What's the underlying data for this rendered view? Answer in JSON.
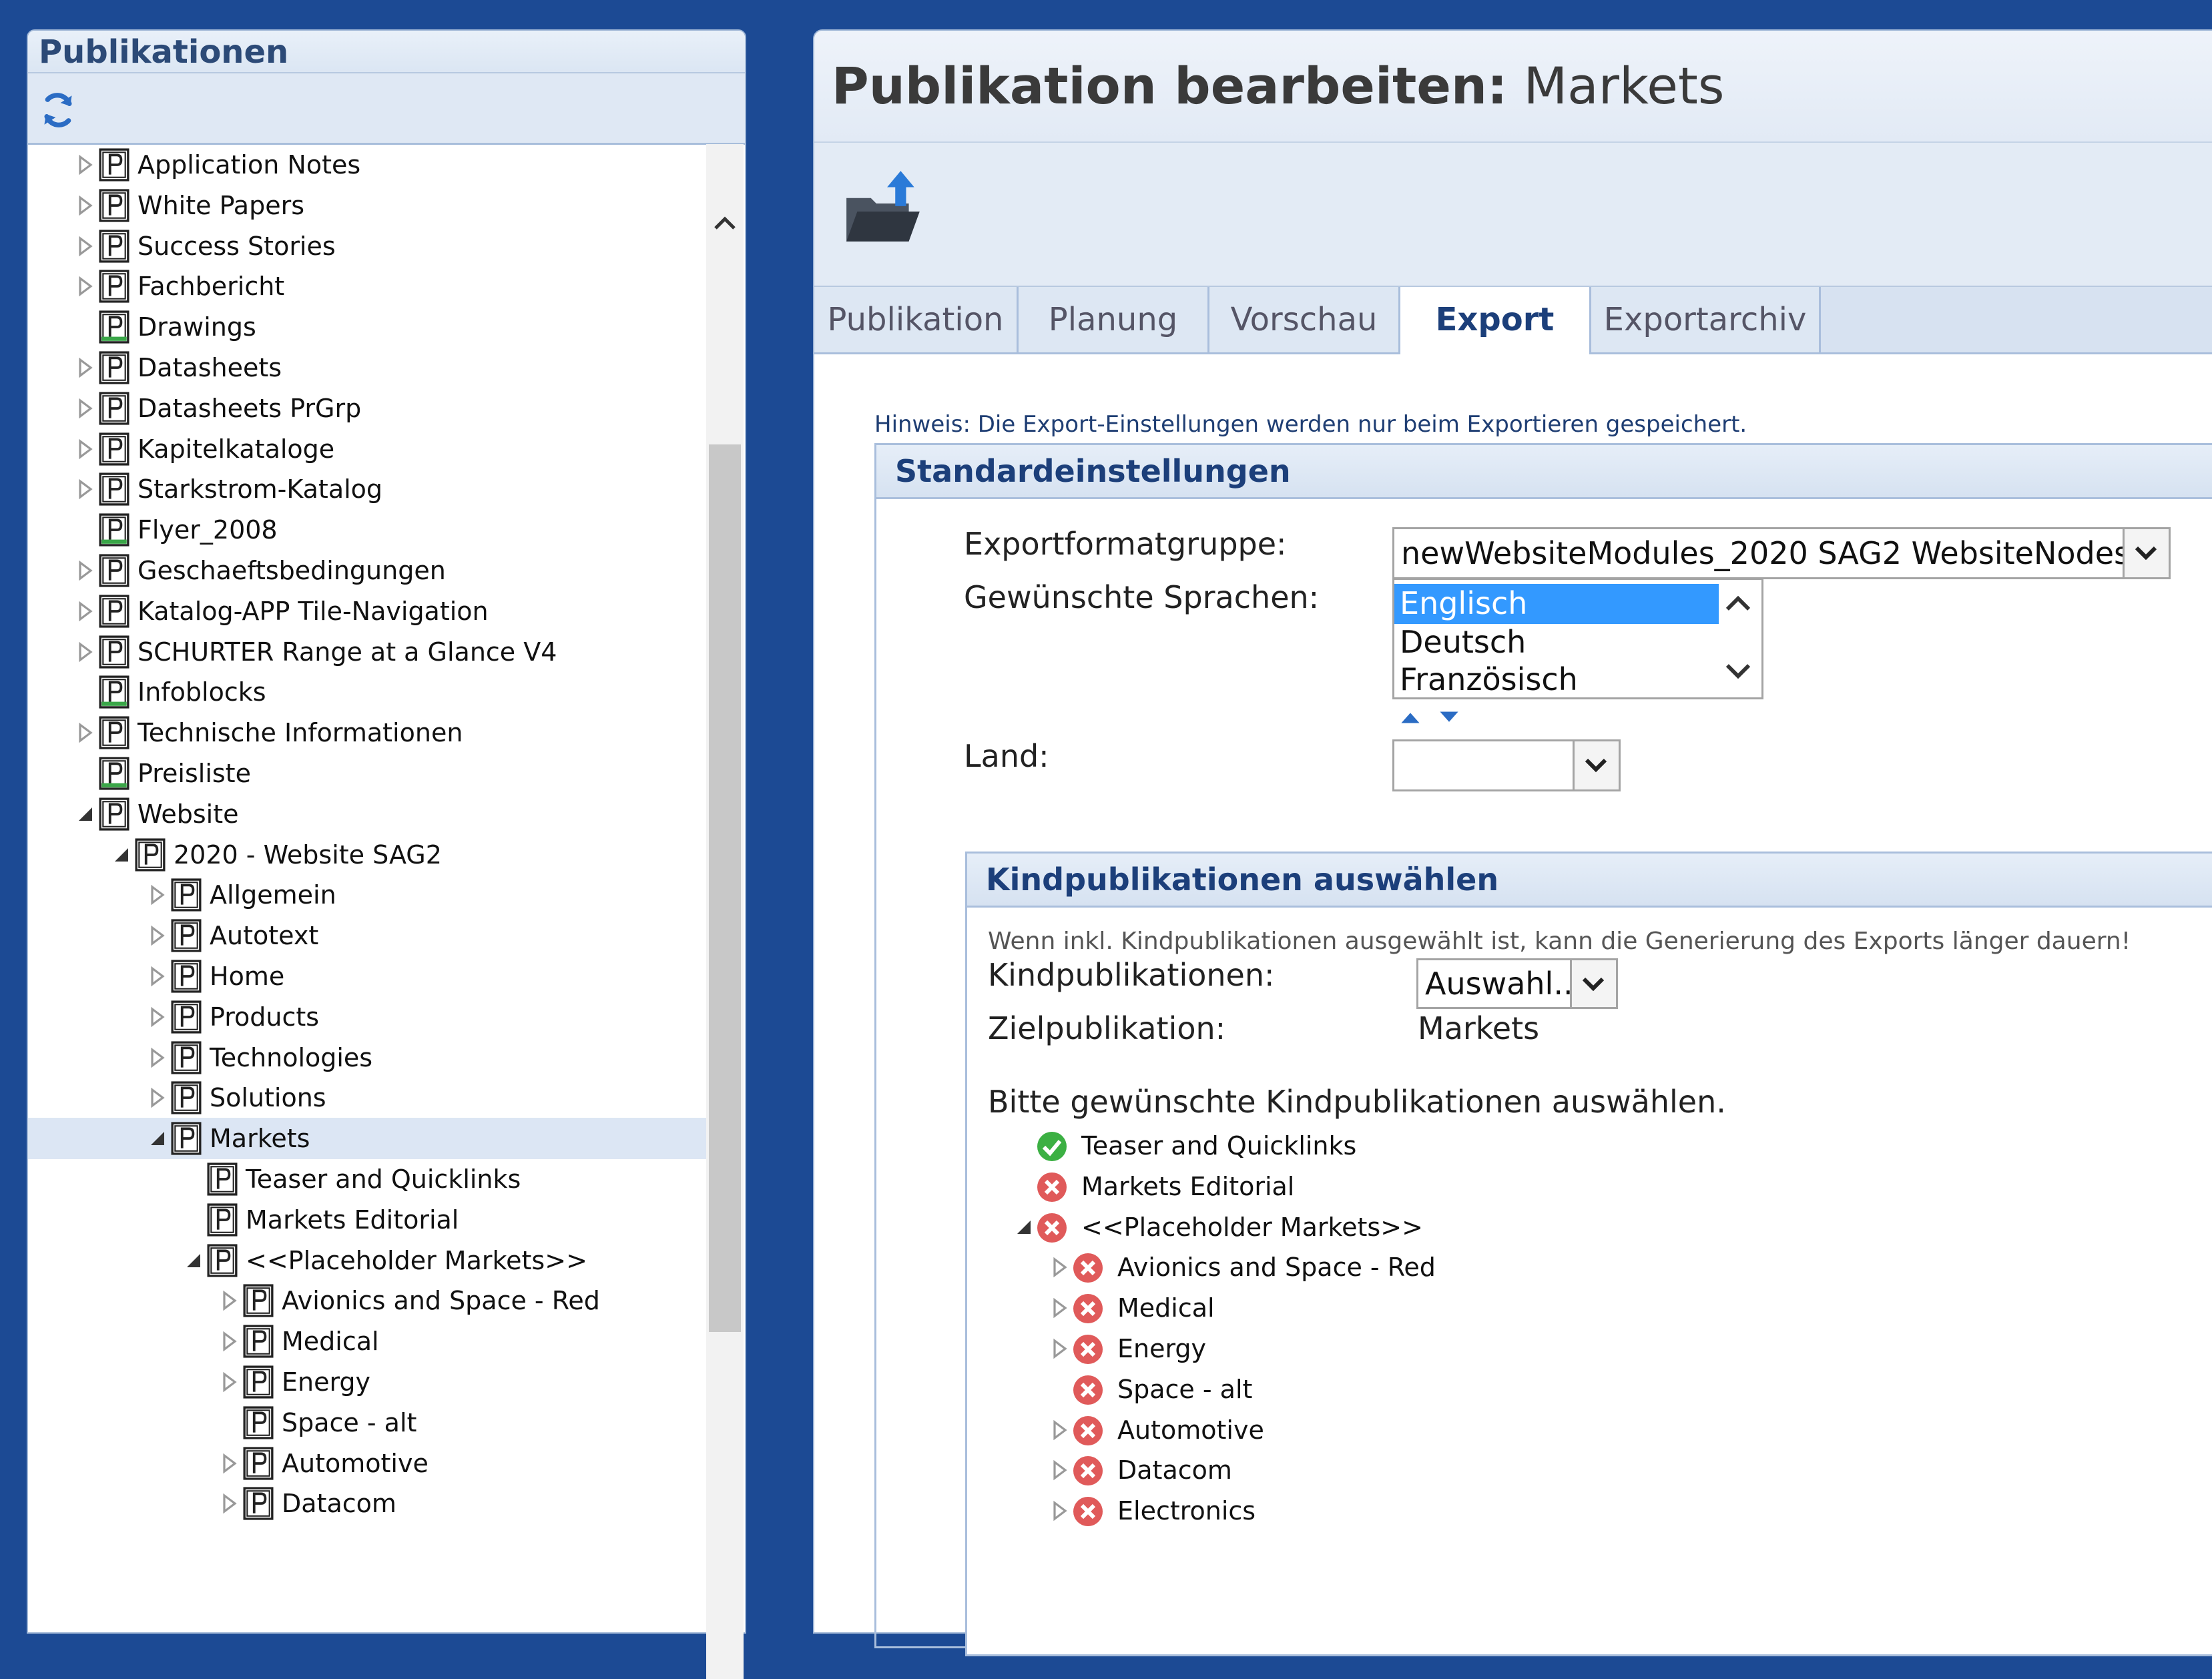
{
  "left_panel": {
    "title": "Publikationen",
    "tree": [
      {
        "label": "Application Notes",
        "depth": 0,
        "toggle": "collapsed"
      },
      {
        "label": "White Papers",
        "depth": 0,
        "toggle": "collapsed"
      },
      {
        "label": "Success Stories",
        "depth": 0,
        "toggle": "collapsed"
      },
      {
        "label": "Fachbericht",
        "depth": 0,
        "toggle": "collapsed"
      },
      {
        "label": "Drawings",
        "depth": 0,
        "toggle": "none"
      },
      {
        "label": "Datasheets",
        "depth": 0,
        "toggle": "collapsed"
      },
      {
        "label": "Datasheets PrGrp",
        "depth": 0,
        "toggle": "collapsed"
      },
      {
        "label": "Kapitelkataloge",
        "depth": 0,
        "toggle": "collapsed"
      },
      {
        "label": "Starkstrom-Katalog",
        "depth": 0,
        "toggle": "collapsed"
      },
      {
        "label": "Flyer_2008",
        "depth": 0,
        "toggle": "none"
      },
      {
        "label": "Geschaeftsbedingungen",
        "depth": 0,
        "toggle": "collapsed"
      },
      {
        "label": "Katalog-APP Tile-Navigation",
        "depth": 0,
        "toggle": "collapsed"
      },
      {
        "label": "SCHURTER Range at a Glance V4",
        "depth": 0,
        "toggle": "collapsed"
      },
      {
        "label": "Infoblocks",
        "depth": 0,
        "toggle": "none"
      },
      {
        "label": "Technische Informationen",
        "depth": 0,
        "toggle": "collapsed"
      },
      {
        "label": "Preisliste",
        "depth": 0,
        "toggle": "none"
      },
      {
        "label": "Website",
        "depth": 0,
        "toggle": "expanded"
      },
      {
        "label": "2020 - Website SAG2",
        "depth": 1,
        "toggle": "expanded"
      },
      {
        "label": "Allgemein",
        "depth": 2,
        "toggle": "collapsed"
      },
      {
        "label": "Autotext",
        "depth": 2,
        "toggle": "collapsed"
      },
      {
        "label": "Home",
        "depth": 2,
        "toggle": "collapsed"
      },
      {
        "label": "Products",
        "depth": 2,
        "toggle": "collapsed"
      },
      {
        "label": "Technologies",
        "depth": 2,
        "toggle": "collapsed"
      },
      {
        "label": "Solutions",
        "depth": 2,
        "toggle": "collapsed"
      },
      {
        "label": "Markets",
        "depth": 2,
        "toggle": "expanded",
        "selected": true
      },
      {
        "label": "Teaser and Quicklinks",
        "depth": 3,
        "toggle": "none"
      },
      {
        "label": "Markets Editorial",
        "depth": 3,
        "toggle": "none"
      },
      {
        "label": "<<Placeholder Markets>>",
        "depth": 3,
        "toggle": "expanded"
      },
      {
        "label": "Avionics and Space - Red",
        "depth": 4,
        "toggle": "collapsed"
      },
      {
        "label": "Medical",
        "depth": 4,
        "toggle": "collapsed"
      },
      {
        "label": "Energy",
        "depth": 4,
        "toggle": "collapsed"
      },
      {
        "label": "Space - alt",
        "depth": 4,
        "toggle": "none"
      },
      {
        "label": "Automotive",
        "depth": 4,
        "toggle": "collapsed"
      },
      {
        "label": "Datacom",
        "depth": 4,
        "toggle": "collapsed"
      }
    ]
  },
  "right_panel": {
    "title_bold": "Publikation bearbeiten:",
    "title_name": "Markets",
    "tabs": [
      "Publikation",
      "Planung",
      "Vorschau",
      "Export",
      "Exportarchiv"
    ],
    "active_tab": "Export",
    "hint": "Hinweis: Die Export-Einstellungen werden nur beim Exportieren gespeichert.",
    "standard": {
      "header": "Standardeinstellungen",
      "format_label": "Exportformatgruppe:",
      "format_value": "newWebsiteModules_2020 SAG2 WebsiteNodes",
      "languages_label": "Gewünschte Sprachen:",
      "languages": [
        "Englisch",
        "Deutsch",
        "Französisch"
      ],
      "selected_language": "Englisch",
      "country_label": "Land:",
      "country_value": ""
    },
    "children": {
      "header": "Kindpublikationen auswählen",
      "warning": "Wenn inkl. Kindpublikationen ausgewählt ist, kann die Generierung des Exports länger dauern!",
      "children_label": "Kindpublikationen:",
      "children_value": "Auswahl...",
      "target_label": "Zielpublikation:",
      "target_value": "Markets",
      "prompt": "Bitte gewünschte Kindpublikationen auswählen.",
      "tree": [
        {
          "label": "Teaser and Quicklinks",
          "depth": 0,
          "toggle": "none",
          "status": "ok"
        },
        {
          "label": "Markets Editorial",
          "depth": 0,
          "toggle": "none",
          "status": "error"
        },
        {
          "label": "<<Placeholder Markets>>",
          "depth": 0,
          "toggle": "expanded",
          "status": "error"
        },
        {
          "label": "Avionics and Space - Red",
          "depth": 1,
          "toggle": "collapsed",
          "status": "error"
        },
        {
          "label": "Medical",
          "depth": 1,
          "toggle": "collapsed",
          "status": "error"
        },
        {
          "label": "Energy",
          "depth": 1,
          "toggle": "collapsed",
          "status": "error"
        },
        {
          "label": "Space - alt",
          "depth": 1,
          "toggle": "none",
          "status": "error"
        },
        {
          "label": "Automotive",
          "depth": 1,
          "toggle": "collapsed",
          "status": "error"
        },
        {
          "label": "Datacom",
          "depth": 1,
          "toggle": "collapsed",
          "status": "error"
        },
        {
          "label": "Electronics",
          "depth": 1,
          "toggle": "collapsed",
          "status": "error"
        }
      ]
    }
  },
  "colors": {
    "background": "#1c4a94",
    "accent": "#1c3f7a",
    "selection": "#3399ff",
    "ok": "#3cb043",
    "error": "#e05a5a"
  }
}
